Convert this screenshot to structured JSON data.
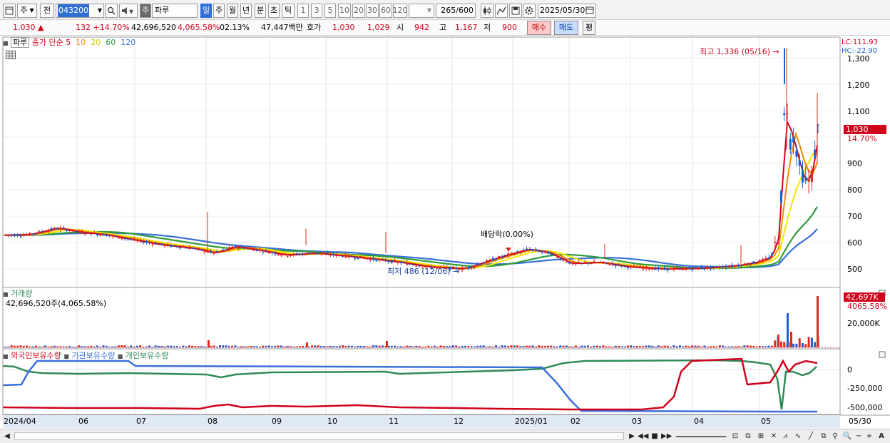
{
  "toolbar": {
    "market_type": "주",
    "prev_label": "전",
    "stock_code": "043200",
    "stock_name": "파루",
    "stock_badge": "주",
    "periods": [
      "일",
      "주",
      "월",
      "년",
      "분",
      "초",
      "틱"
    ],
    "active_period": "일",
    "intervals": [
      "1",
      "3",
      "5",
      "10",
      "20",
      "30",
      "60",
      "120"
    ],
    "count_value": "265",
    "count_total": "/600",
    "date": "2025/05/30"
  },
  "quote": {
    "price": "1,030",
    "price_arrow": "▲",
    "change": "132",
    "change_pct": "+14.70%",
    "volume": "42,696,520",
    "volume_ratio": "4,065.58%",
    "turnover": "02.13%",
    "amount": "47,447백만",
    "ask_label": "호가",
    "ask": "1,030",
    "bid": "1,029",
    "open_label": "시",
    "open": "942",
    "high_label": "고",
    "high": "1,167",
    "low_label": "저",
    "low": "900",
    "buy_button": "매수",
    "sell_button": "매도",
    "eval_button": "평"
  },
  "price_panel": {
    "name": "파루",
    "legend_title": "종가 단순",
    "ma_periods": [
      "5",
      "10",
      "20",
      "60",
      "120"
    ],
    "lc": "LC:111.93",
    "hc": "HC:-22.90",
    "high_annotation": "최고 1,336 (05/16)",
    "low_annotation": "최저 486 (12/06)",
    "dividend_annotation": "배당락(0.00%)",
    "current_price_tag": "1,030",
    "current_pct_tag": "14.70%",
    "y_ticks": [
      "1,300",
      "1,200",
      "1,100",
      "1,000",
      "900",
      "800",
      "700",
      "600",
      "500"
    ]
  },
  "volume_panel": {
    "title": "거래량",
    "value_text": "42,696,520주(4,065.58%)",
    "tag": "42,697K",
    "tag_pct": "4065.58%",
    "y_tick": "20,000K"
  },
  "holding_panel": {
    "legend": [
      "외국인보유수량",
      "기관보유수량",
      "개인보유수량"
    ],
    "y_ticks": [
      "0",
      "-250,000",
      "-500,000"
    ]
  },
  "x_axis": [
    "2024/04",
    "06",
    "07",
    "08",
    "09",
    "10",
    "11",
    "12",
    "2025/01",
    "02",
    "03",
    "04",
    "05"
  ],
  "x_axis_right": "05/30",
  "colors": {
    "up": "#e0281e",
    "down": "#1f5fcf",
    "ma5": "#d0021b",
    "ma10": "#f08c00",
    "ma20": "#f2e600",
    "ma60": "#2e9b3a",
    "ma120": "#3a6fd8",
    "foreign": "#d0021b",
    "institution": "#3a6fd8",
    "individual": "#2e8b57"
  }
}
